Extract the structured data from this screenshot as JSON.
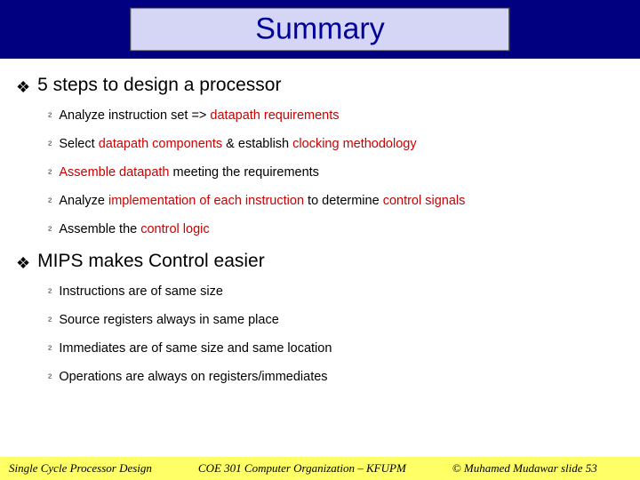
{
  "title": "Summary",
  "sections": [
    {
      "heading": "5 steps to design a processor",
      "items": [
        {
          "segments": [
            {
              "t": "Analyze instruction set => ",
              "r": false
            },
            {
              "t": "datapath requirements",
              "r": true
            }
          ]
        },
        {
          "segments": [
            {
              "t": "Select ",
              "r": false
            },
            {
              "t": "datapath components",
              "r": true
            },
            {
              "t": " & establish ",
              "r": false
            },
            {
              "t": "clocking methodology",
              "r": true
            }
          ]
        },
        {
          "segments": [
            {
              "t": "Assemble datapath",
              "r": true
            },
            {
              "t": " meeting the requirements",
              "r": false
            }
          ]
        },
        {
          "segments": [
            {
              "t": "Analyze ",
              "r": false
            },
            {
              "t": "implementation of each instruction",
              "r": true
            },
            {
              "t": " to determine ",
              "r": false
            },
            {
              "t": "control signals",
              "r": true
            }
          ]
        },
        {
          "segments": [
            {
              "t": "Assemble the ",
              "r": false
            },
            {
              "t": "control logic",
              "r": true
            }
          ]
        }
      ]
    },
    {
      "heading": "MIPS makes Control easier",
      "items": [
        {
          "segments": [
            {
              "t": "Instructions are of same size",
              "r": false
            }
          ]
        },
        {
          "segments": [
            {
              "t": "Source registers always in same place",
              "r": false
            }
          ]
        },
        {
          "segments": [
            {
              "t": "Immediates are of same size and same location",
              "r": false
            }
          ]
        },
        {
          "segments": [
            {
              "t": "Operations are always on registers/immediates",
              "r": false
            }
          ]
        }
      ]
    }
  ],
  "footer": {
    "left": "Single Cycle Processor Design",
    "center": "COE 301 Computer Organization – KFUPM",
    "right": "© Muhamed Mudawar  slide 53"
  },
  "bullets": {
    "l1": "❖",
    "l2": "²"
  }
}
